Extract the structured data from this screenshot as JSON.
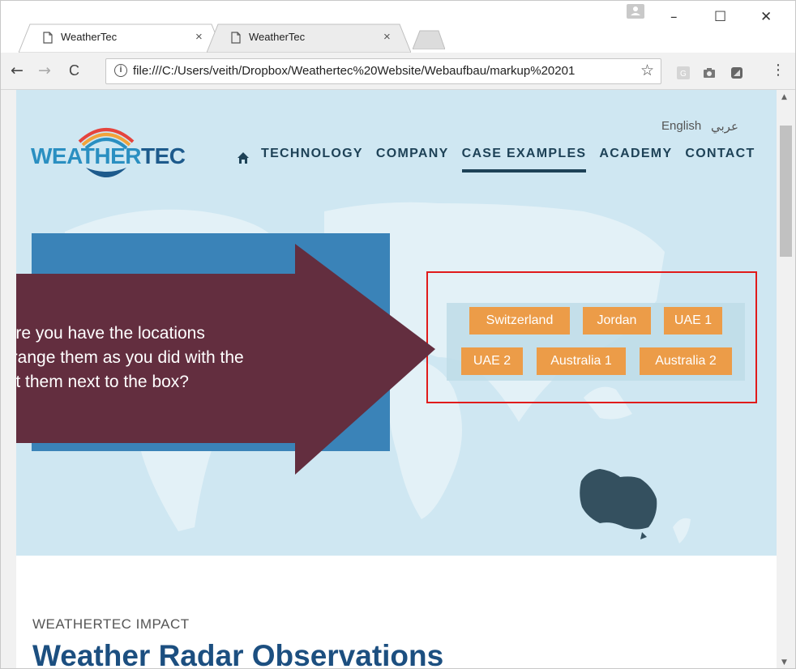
{
  "browser": {
    "tabs": [
      {
        "title": "WeatherTec",
        "active": true
      },
      {
        "title": "WeatherTec",
        "active": false
      }
    ],
    "close_glyph": "×",
    "window_controls": {
      "minimize": "–",
      "maximize": "☐",
      "close": "✕"
    },
    "nav": {
      "back": "←",
      "forward": "→",
      "reload": "C"
    },
    "address_bar": {
      "info_glyph": "i",
      "url": "file:///C:/Users/veith/Dropbox/Weathertec%20Website/Webaufbau/markup%20201",
      "bookmark_glyph": "☆"
    },
    "menu_glyph": "⋮",
    "extensions": [
      "g-extension-icon",
      "camera-extension-icon",
      "shape-extension-icon"
    ]
  },
  "site": {
    "logo": {
      "part1": "WEATHER",
      "part2": "TEC"
    },
    "language": {
      "english": "English",
      "arabic": "عربي"
    },
    "nav": {
      "home_icon": "home-icon",
      "items": [
        "TECHNOLOGY",
        "COMPANY",
        "CASE EXAMPLES",
        "ACADEMY",
        "CONTACT"
      ],
      "active": "CASE EXAMPLES"
    },
    "locations": [
      "Switzerland",
      "Jordan",
      "UAE 1",
      "UAE 2",
      "Australia 1",
      "Australia 2"
    ],
    "section_label": "WEATHERTEC IMPACT",
    "section_title": "Weather Radar Observations"
  },
  "annotation": {
    "lines": [
      "here you have the locations",
      "arrange them as you did with the",
      "but them next to the box?"
    ],
    "arrow_color": "#632e3f",
    "frame_color": "#e01b1b"
  },
  "colors": {
    "brand_blue": "#2a8fc1",
    "brand_navy": "#1e4257",
    "location_button": "#ec9c48",
    "hero_bg": "#cfe7f2"
  }
}
